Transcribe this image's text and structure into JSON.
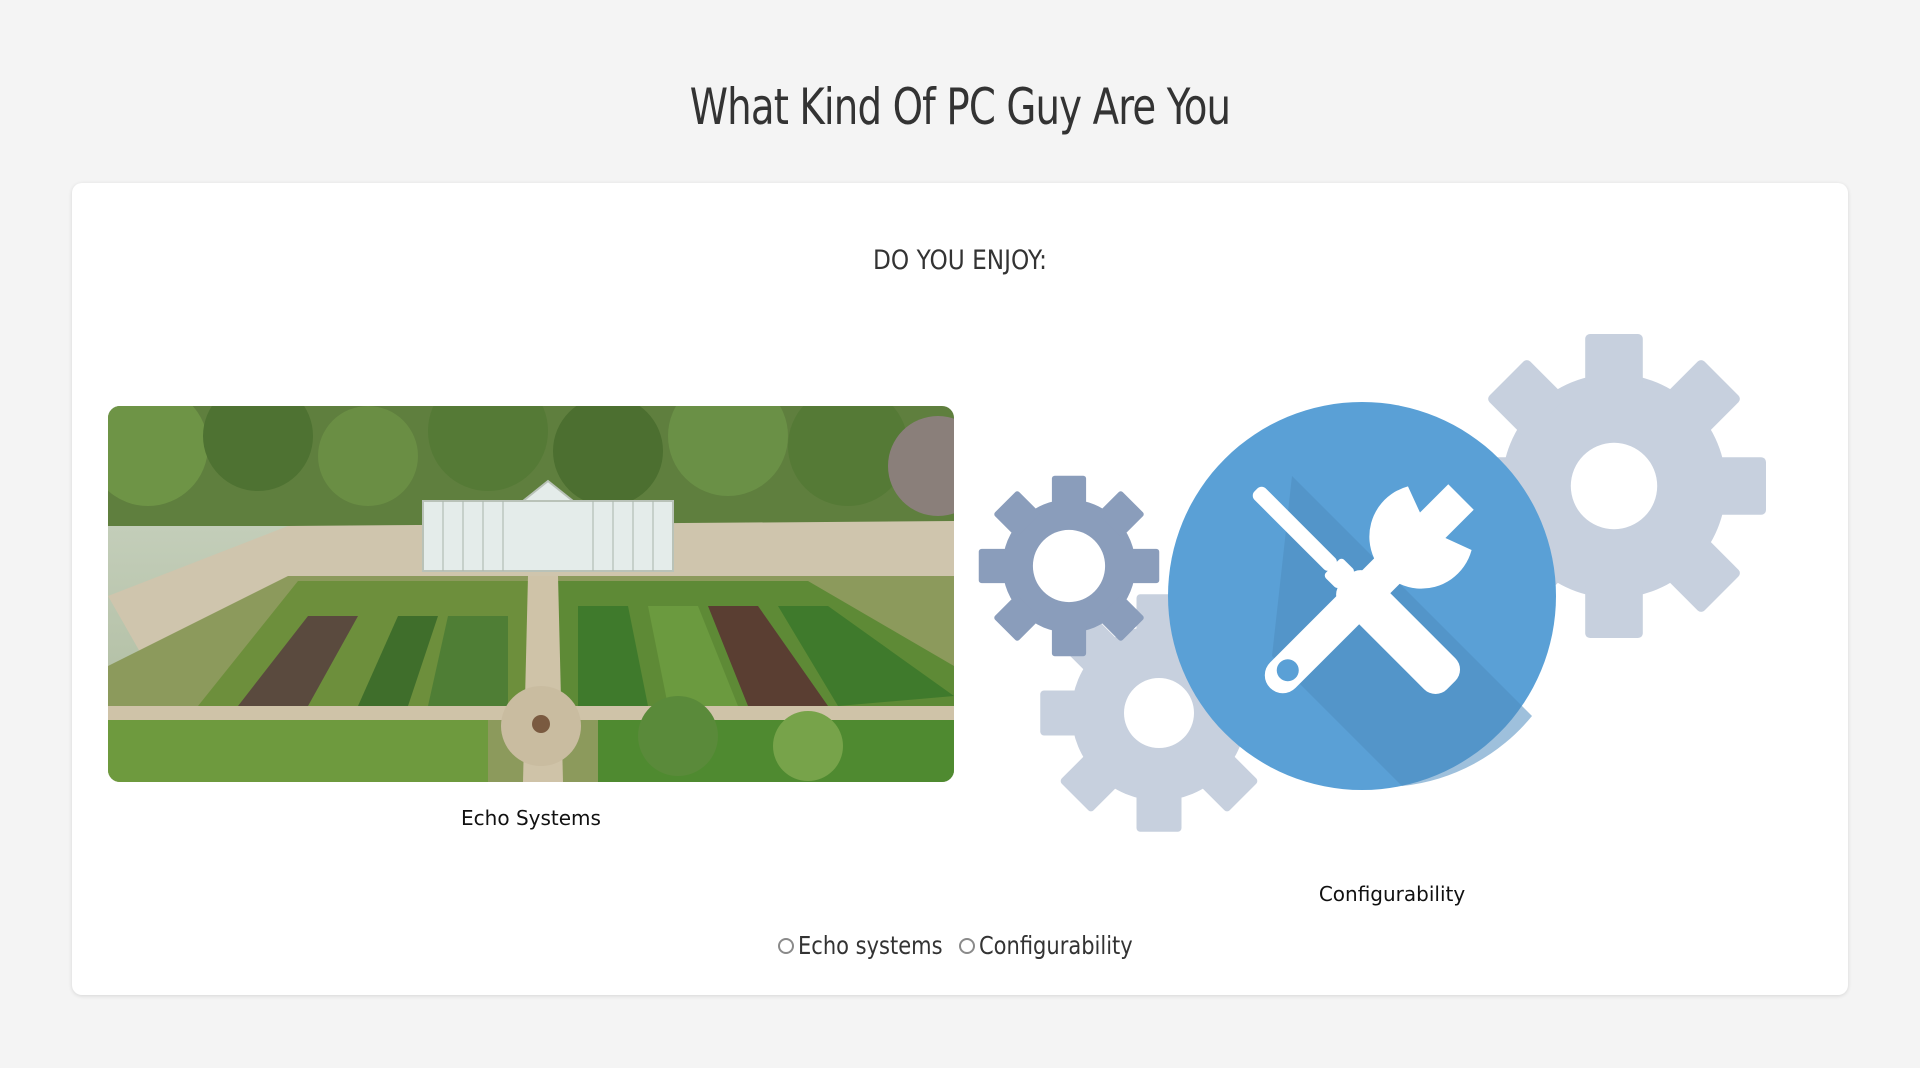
{
  "page": {
    "title": "What Kind Of PC Guy Are You"
  },
  "quiz": {
    "question": "DO YOU ENJOY:",
    "options": [
      {
        "caption": "Echo Systems",
        "radio_label": "Echo systems",
        "image": "garden-photo"
      },
      {
        "caption": "Configurability",
        "radio_label": "Configurability",
        "image": "tools-gears-icon"
      }
    ]
  },
  "colors": {
    "background": "#f4f4f4",
    "card": "#ffffff",
    "tool_circle": "#5aa0d6",
    "gear_dark": "#8a9dbb",
    "gear_light": "#c7d0de"
  }
}
